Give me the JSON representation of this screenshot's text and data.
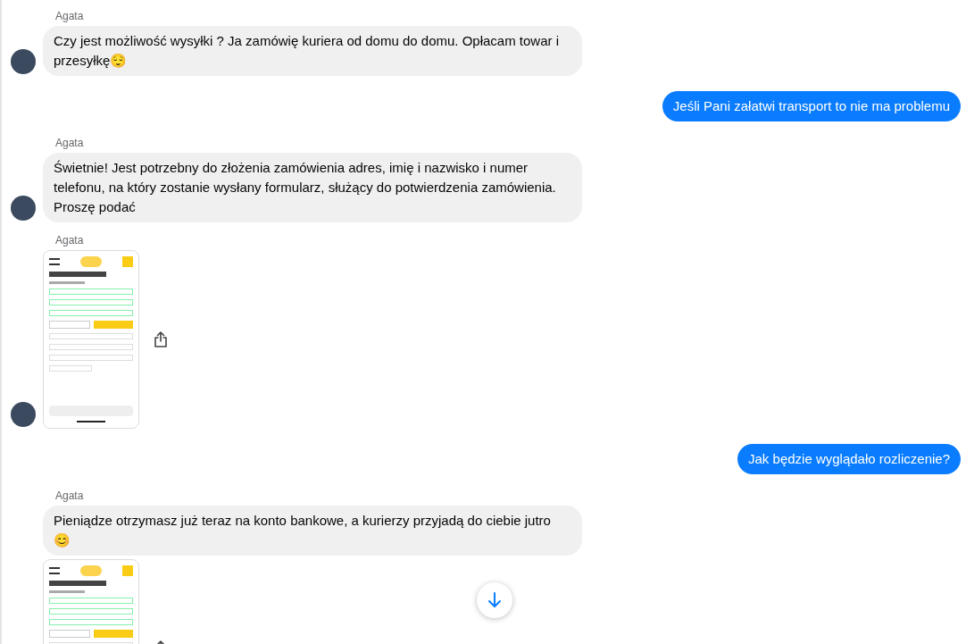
{
  "messages": [
    {
      "kind": "incoming",
      "sender": "Agata",
      "avatar": true,
      "items": [
        {
          "kind": "text",
          "text": "Czy jest możliwość wysyłki ? Ja zamówię kuriera od domu do domu. Opłacam towar i przesyłkę😌"
        }
      ]
    },
    {
      "kind": "outgoing",
      "items": [
        {
          "kind": "text",
          "text": "Jeśli Pani załatwi transport to nie ma problemu"
        }
      ]
    },
    {
      "kind": "incoming",
      "sender": "Agata",
      "avatar": true,
      "items": [
        {
          "kind": "text",
          "text": "Świetnie! Jest potrzebny do złożenia zamówienia adres, imię i nazwisko i numer telefonu, na który zostanie wysłany formularz, służący do potwierdzenia zamówienia. Proszę podać"
        }
      ]
    },
    {
      "kind": "incoming",
      "sender": "Agata",
      "avatar": true,
      "items": [
        {
          "kind": "image"
        }
      ]
    },
    {
      "kind": "outgoing",
      "items": [
        {
          "kind": "text",
          "text": "Jak będzie wyglądało rozliczenie?"
        }
      ]
    },
    {
      "kind": "incoming",
      "sender": "Agata",
      "avatar": false,
      "items": [
        {
          "kind": "text",
          "text": "Pieniądze otrzymasz już teraz na konto bankowe, a kurierzy przyjadą do ciebie jutro 😊"
        },
        {
          "kind": "image"
        }
      ]
    }
  ]
}
